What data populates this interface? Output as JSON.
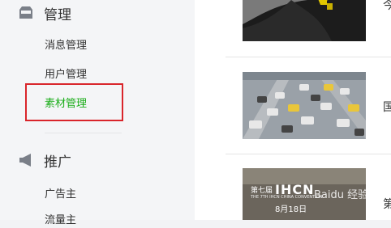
{
  "sidebar": {
    "sections": [
      {
        "title": "管理",
        "icon": "inbox-icon"
      },
      {
        "title": "推广",
        "icon": "megaphone-icon"
      }
    ],
    "management_items": [
      "消息管理",
      "用户管理",
      "素材管理"
    ],
    "promotion_items": [
      "广告主",
      "流量主"
    ],
    "active_item": "素材管理",
    "accent_color": "#1aad19",
    "highlight_color": "#d9252b"
  },
  "content": {
    "rows": [
      {
        "title_fragment": "今"
      },
      {
        "title_fragment": "国"
      },
      {
        "title_fragment": "第"
      }
    ],
    "thumb3": {
      "brand": "IHCN",
      "subtitle": "第七届",
      "tagline": "THE 7TH IHCN CHINA CONVENTION",
      "date": "8月18日",
      "watermark": "Baidu 经验"
    }
  }
}
